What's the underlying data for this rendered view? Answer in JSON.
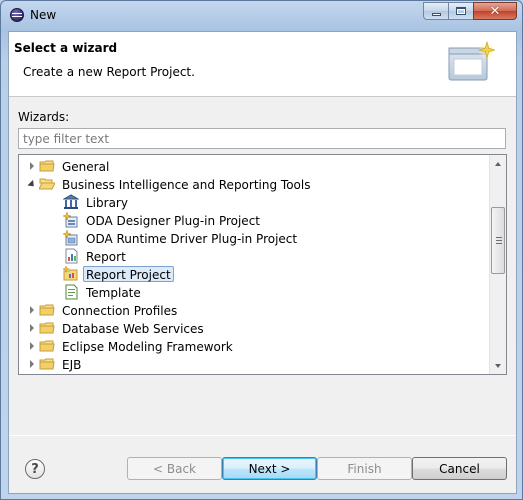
{
  "window": {
    "title": "New"
  },
  "banner": {
    "title": "Select a wizard",
    "subtitle": "Create a new Report Project."
  },
  "wizards": {
    "label": "Wizards:",
    "filter_placeholder": "type filter text",
    "filter_value": ""
  },
  "tree": {
    "items": [
      {
        "label": "General",
        "level": 0,
        "kind": "folder",
        "state": "collapsed"
      },
      {
        "label": "Business Intelligence and Reporting Tools",
        "level": 0,
        "kind": "folder-open",
        "state": "expanded"
      },
      {
        "label": "Library",
        "level": 1,
        "kind": "library-icon"
      },
      {
        "label": "ODA Designer Plug-in Project",
        "level": 1,
        "kind": "plugin-icon"
      },
      {
        "label": "ODA Runtime Driver Plug-in Project",
        "level": 1,
        "kind": "plugin-icon"
      },
      {
        "label": "Report",
        "level": 1,
        "kind": "report-icon"
      },
      {
        "label": "Report Project",
        "level": 1,
        "kind": "report-project-icon",
        "selected": true
      },
      {
        "label": "Template",
        "level": 1,
        "kind": "template-icon"
      },
      {
        "label": "Connection Profiles",
        "level": 0,
        "kind": "folder",
        "state": "collapsed"
      },
      {
        "label": "Database Web Services",
        "level": 0,
        "kind": "folder",
        "state": "collapsed"
      },
      {
        "label": "Eclipse Modeling Framework",
        "level": 0,
        "kind": "folder",
        "state": "collapsed"
      },
      {
        "label": "EJB",
        "level": 0,
        "kind": "folder",
        "state": "collapsed"
      }
    ]
  },
  "buttons": {
    "back": "< Back",
    "next": "Next >",
    "finish": "Finish",
    "cancel": "Cancel",
    "help": "?"
  },
  "colors": {
    "selection_bg": "#dcebfc",
    "selection_border": "#7da2ce",
    "folder": "#e8c66a"
  }
}
